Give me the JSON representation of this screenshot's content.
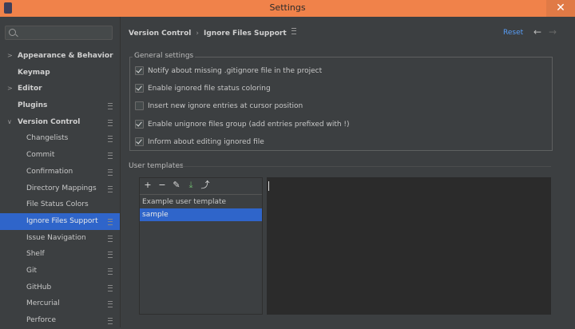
{
  "window": {
    "title": "Settings",
    "close_glyph": "✕"
  },
  "search": {
    "placeholder": ""
  },
  "sidebar": {
    "items": [
      {
        "label": "Appearance & Behavior"
      },
      {
        "label": "Keymap"
      },
      {
        "label": "Editor"
      },
      {
        "label": "Plugins"
      },
      {
        "label": "Version Control"
      },
      {
        "label": "Changelists"
      },
      {
        "label": "Commit"
      },
      {
        "label": "Confirmation"
      },
      {
        "label": "Directory Mappings"
      },
      {
        "label": "File Status Colors"
      },
      {
        "label": "Ignore Files Support"
      },
      {
        "label": "Issue Navigation"
      },
      {
        "label": "Shelf"
      },
      {
        "label": "Git"
      },
      {
        "label": "GitHub"
      },
      {
        "label": "Mercurial"
      },
      {
        "label": "Perforce"
      }
    ],
    "selected": "Ignore Files Support"
  },
  "header": {
    "crumb1": "Version Control",
    "crumb_sep": "›",
    "crumb2": "Ignore Files Support",
    "reset": "Reset",
    "back_glyph": "←",
    "forward_glyph": "→"
  },
  "general": {
    "title": "General settings",
    "options": [
      {
        "label": "Notify about missing .gitignore file in the project",
        "checked": true
      },
      {
        "label": "Enable ignored file status coloring",
        "checked": true
      },
      {
        "label": "Insert new ignore entries at cursor position",
        "checked": false
      },
      {
        "label": "Enable unignore files group (add entries prefixed with !)",
        "checked": true
      },
      {
        "label": "Inform about editing ignored file",
        "checked": true
      }
    ]
  },
  "templates": {
    "label": "User templates",
    "toolbar": {
      "add": "+",
      "remove": "−",
      "edit": "✎",
      "import": "⤓",
      "export": "⤴"
    },
    "items": [
      {
        "label": "Example user template"
      },
      {
        "label": "sample"
      }
    ],
    "selected": "sample",
    "editor_text": ""
  },
  "colors": {
    "accent": "#2f65ca",
    "link": "#589df6",
    "titlebar": "#f0824a"
  }
}
